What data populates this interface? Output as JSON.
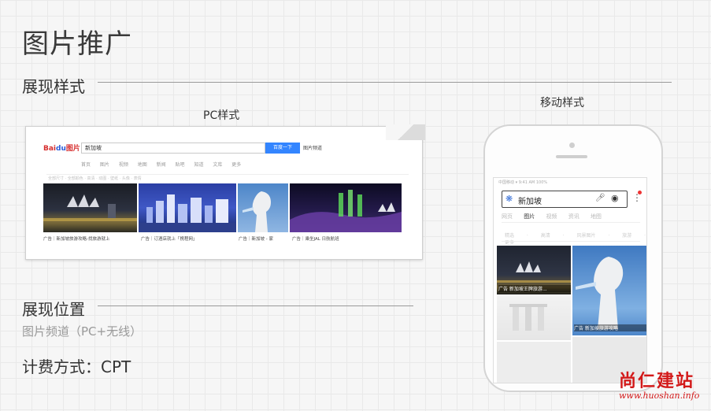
{
  "page": {
    "title": "图片推广",
    "section_display_style": "展现样式",
    "section_display_position": "展现位置",
    "position_desc": "图片频道（PC+无线）",
    "billing": "计费方式：CPT",
    "pc_label": "PC样式",
    "mobile_label": "移动样式"
  },
  "pc_preview": {
    "logo_text": "Bai",
    "logo_paw": "du",
    "logo_suffix": "图片",
    "search_value": "新加坡",
    "search_button": "百度一下",
    "search_link": "图片频道",
    "nav": "首页 图片 视频 地图 新闻 贴吧 知道 文库 更多",
    "filter": "全部尺寸 · 全部颜色 · 高清 · 动图 · 壁纸 · 头像 · 表情",
    "captions": [
      "广告｜新加坡旅游攻略-找旅游就上",
      "广告｜订酒店就上「携程网」",
      "广告｜新加坡 - 家",
      "广告｜乘坐JAL 日航航班"
    ]
  },
  "mobile_preview": {
    "status": "中国移动 ▾   9:41 AM   100%",
    "search_value": "新加坡",
    "tabs": [
      "网页",
      "图片",
      "视频",
      "资讯",
      "地图"
    ],
    "active_tab": "图片",
    "filters": "精选 · 高清 · 风景图片 · 旅游 · 更多",
    "captions": [
      "广告 新加坡王牌旅游...",
      "广告 新加坡旅游攻略"
    ]
  },
  "watermark": {
    "cn": "尚仁建站",
    "url": "www.huoshan.info"
  }
}
